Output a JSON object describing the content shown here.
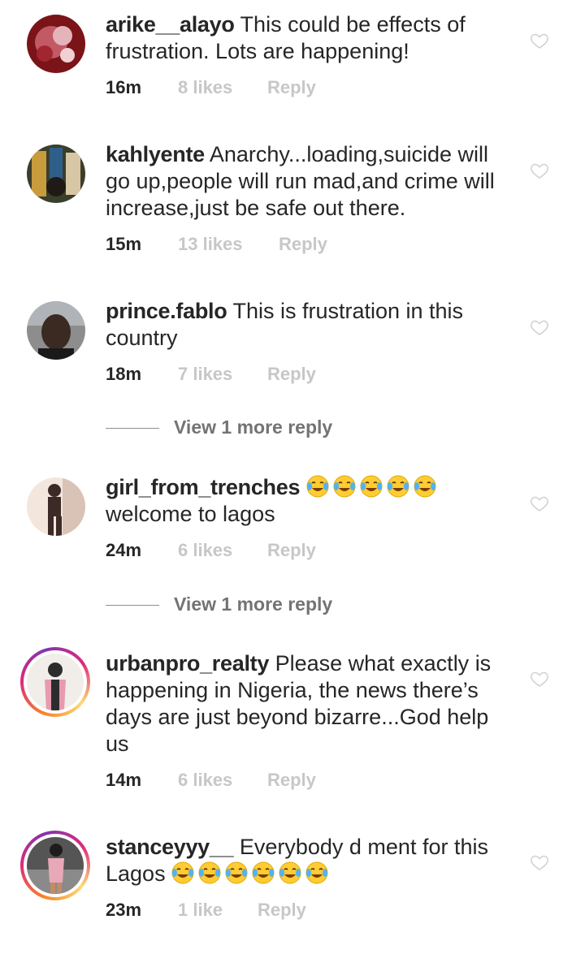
{
  "comments": [
    {
      "username": "arike__alayo",
      "text": " This could be effects of frustration. Lots are happening!",
      "time": "16m",
      "likes": "8 likes",
      "reply": "Reply",
      "avatar_colors": [
        "#8b1a1a",
        "#d9a0a6",
        "#6e0f14"
      ]
    },
    {
      "username": "kahlyente",
      "text": " Anarchy...loading,suicide will go up,people will run mad,and crime will increase,just be safe out there.",
      "time": "15m",
      "likes": "13 likes",
      "reply": "Reply",
      "avatar_colors": [
        "#3a3f2c",
        "#c89b3c",
        "#2e5f8a"
      ]
    },
    {
      "username": "prince.fablo",
      "text": " This is frustration in this country",
      "time": "18m",
      "likes": "7 likes",
      "reply": "Reply",
      "view_more": "View 1 more reply",
      "avatar_colors": [
        "#3b2a22",
        "#8d8d8d",
        "#1a1a1a"
      ]
    },
    {
      "username": "girl_from_trenches",
      "text_after_emoji": "welcome to lagos",
      "emoji_count": 5,
      "time": "24m",
      "likes": "6 likes",
      "reply": "Reply",
      "view_more": "View 1 more reply",
      "avatar_colors": [
        "#d9c3b6",
        "#3b2a25",
        "#f2e6dd"
      ]
    },
    {
      "username": "urbanpro_realty",
      "text": " Please what exactly is happening in Nigeria, the news there’s days are just beyond bizarre...God help us",
      "time": "14m",
      "likes": "6 likes",
      "reply": "Reply",
      "avatar_colors": [
        "#f1eee9",
        "#e79ab0",
        "#2c2c2c"
      ]
    },
    {
      "username": "stanceyyy__",
      "text": " Everybody d ment for this",
      "text_line2": "Lagos",
      "emoji_count": 6,
      "time": "23m",
      "likes": "1 like",
      "reply": "Reply",
      "avatar_colors": [
        "#555555",
        "#e7a9b8",
        "#1d1d1d"
      ]
    }
  ],
  "icons": {
    "heart": "heart-outline-icon",
    "emoji": "face-with-tears-of-joy-icon"
  },
  "colors": {
    "text": "#262626",
    "secondary": "#8e8e8e",
    "faint": "#c7c7c7",
    "story_ring": [
      "#f58529",
      "#dd2a7b",
      "#8134af"
    ]
  }
}
